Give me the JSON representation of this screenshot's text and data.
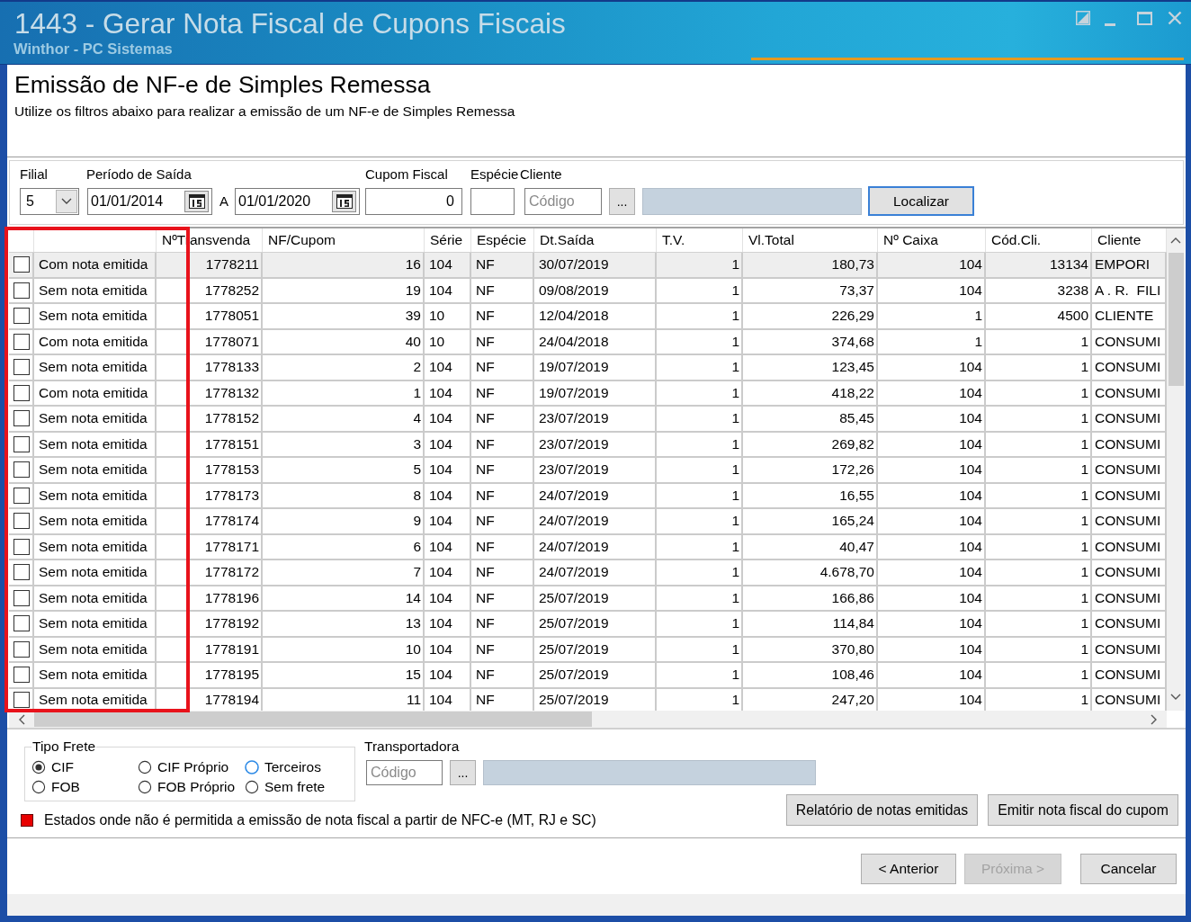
{
  "window": {
    "title": "1443 - Gerar Nota Fiscal de Cupons Fiscais",
    "subtitle": "Winthor - PC Sistemas"
  },
  "intro": {
    "heading": "Emissão de NF-e de Simples Remessa",
    "description": "Utilize os filtros abaixo para realizar a emissão de um NF-e de Simples Remessa"
  },
  "filters": {
    "filial": {
      "label": "Filial",
      "value": "5"
    },
    "periodo": {
      "label": "Período de Saída",
      "from": "01/01/2014",
      "separator": "A",
      "to": "01/01/2020"
    },
    "cupom_fiscal": {
      "label": "Cupom Fiscal",
      "value": "0"
    },
    "especie": {
      "label": "Espécie"
    },
    "cliente": {
      "label": "Cliente",
      "placeholder": "Código",
      "lookup_button": "..."
    },
    "search_button": "Localizar"
  },
  "table": {
    "columns": [
      "NºTransvenda",
      "NF/Cupom",
      "Série",
      "Espécie",
      "Dt.Saída",
      "T.V.",
      "Vl.Total",
      "Nº Caixa",
      "Cód.Cli.",
      "Cliente"
    ],
    "rows": [
      {
        "checked": false,
        "selected": true,
        "status": "Com nota emitida",
        "cells": [
          "1778211",
          "16",
          "104",
          "NF",
          "30/07/2019",
          "1",
          "180,73",
          "104",
          "13134",
          "EMPORI"
        ]
      },
      {
        "checked": false,
        "selected": false,
        "status": "Sem nota emitida",
        "cells": [
          "1778252",
          "19",
          "104",
          "NF",
          "09/08/2019",
          "1",
          "73,37",
          "104",
          "3238",
          "A . R.  FILI"
        ]
      },
      {
        "checked": false,
        "selected": false,
        "status": "Sem nota emitida",
        "cells": [
          "1778051",
          "39",
          "10",
          "NF",
          "12/04/2018",
          "1",
          "226,29",
          "1",
          "4500",
          "CLIENTE"
        ]
      },
      {
        "checked": false,
        "selected": false,
        "status": "Com nota emitida",
        "cells": [
          "1778071",
          "40",
          "10",
          "NF",
          "24/04/2018",
          "1",
          "374,68",
          "1",
          "1",
          "CONSUMI"
        ]
      },
      {
        "checked": false,
        "selected": false,
        "status": "Sem nota emitida",
        "cells": [
          "1778133",
          "2",
          "104",
          "NF",
          "19/07/2019",
          "1",
          "123,45",
          "104",
          "1",
          "CONSUMI"
        ]
      },
      {
        "checked": false,
        "selected": false,
        "status": "Com nota emitida",
        "cells": [
          "1778132",
          "1",
          "104",
          "NF",
          "19/07/2019",
          "1",
          "418,22",
          "104",
          "1",
          "CONSUMI"
        ]
      },
      {
        "checked": false,
        "selected": false,
        "status": "Sem nota emitida",
        "cells": [
          "1778152",
          "4",
          "104",
          "NF",
          "23/07/2019",
          "1",
          "85,45",
          "104",
          "1",
          "CONSUMI"
        ]
      },
      {
        "checked": false,
        "selected": false,
        "status": "Sem nota emitida",
        "cells": [
          "1778151",
          "3",
          "104",
          "NF",
          "23/07/2019",
          "1",
          "269,82",
          "104",
          "1",
          "CONSUMI"
        ]
      },
      {
        "checked": false,
        "selected": false,
        "status": "Sem nota emitida",
        "cells": [
          "1778153",
          "5",
          "104",
          "NF",
          "23/07/2019",
          "1",
          "172,26",
          "104",
          "1",
          "CONSUMI"
        ]
      },
      {
        "checked": false,
        "selected": false,
        "status": "Sem nota emitida",
        "cells": [
          "1778173",
          "8",
          "104",
          "NF",
          "24/07/2019",
          "1",
          "16,55",
          "104",
          "1",
          "CONSUMI"
        ]
      },
      {
        "checked": false,
        "selected": false,
        "status": "Sem nota emitida",
        "cells": [
          "1778174",
          "9",
          "104",
          "NF",
          "24/07/2019",
          "1",
          "165,24",
          "104",
          "1",
          "CONSUMI"
        ]
      },
      {
        "checked": false,
        "selected": false,
        "status": "Sem nota emitida",
        "cells": [
          "1778171",
          "6",
          "104",
          "NF",
          "24/07/2019",
          "1",
          "40,47",
          "104",
          "1",
          "CONSUMI"
        ]
      },
      {
        "checked": false,
        "selected": false,
        "status": "Sem nota emitida",
        "cells": [
          "1778172",
          "7",
          "104",
          "NF",
          "24/07/2019",
          "1",
          "4.678,70",
          "104",
          "1",
          "CONSUMI"
        ]
      },
      {
        "checked": false,
        "selected": false,
        "status": "Sem nota emitida",
        "cells": [
          "1778196",
          "14",
          "104",
          "NF",
          "25/07/2019",
          "1",
          "166,86",
          "104",
          "1",
          "CONSUMI"
        ]
      },
      {
        "checked": false,
        "selected": false,
        "status": "Sem nota emitida",
        "cells": [
          "1778192",
          "13",
          "104",
          "NF",
          "25/07/2019",
          "1",
          "114,84",
          "104",
          "1",
          "CONSUMI"
        ]
      },
      {
        "checked": false,
        "selected": false,
        "status": "Sem nota emitida",
        "cells": [
          "1778191",
          "10",
          "104",
          "NF",
          "25/07/2019",
          "1",
          "370,80",
          "104",
          "1",
          "CONSUMI"
        ]
      },
      {
        "checked": false,
        "selected": false,
        "status": "Sem nota emitida",
        "cells": [
          "1778195",
          "15",
          "104",
          "NF",
          "25/07/2019",
          "1",
          "108,46",
          "104",
          "1",
          "CONSUMI"
        ]
      },
      {
        "checked": false,
        "selected": false,
        "status": "Sem nota emitida",
        "cells": [
          "1778194",
          "11",
          "104",
          "NF",
          "25/07/2019",
          "1",
          "247,20",
          "104",
          "1",
          "CONSUMI"
        ]
      }
    ]
  },
  "freight": {
    "label": "Tipo Frete",
    "options": [
      {
        "label": "CIF",
        "selected": true,
        "highlighted": false
      },
      {
        "label": "CIF Próprio",
        "selected": false,
        "highlighted": false
      },
      {
        "label": "Terceiros",
        "selected": false,
        "highlighted": true
      },
      {
        "label": "FOB",
        "selected": false,
        "highlighted": false
      },
      {
        "label": "FOB Próprio",
        "selected": false,
        "highlighted": false
      },
      {
        "label": "Sem frete",
        "selected": false,
        "highlighted": false
      }
    ]
  },
  "carrier": {
    "label": "Transportadora",
    "placeholder": "Código",
    "lookup_button": "..."
  },
  "note": "Estados onde não é permitida a emissão de nota fiscal a partir de NFC-e (MT, RJ e SC)",
  "actions": [
    "Relatório de notas emitidas",
    "Emitir nota fiscal do cupom"
  ],
  "navigation": [
    {
      "label": "< Anterior",
      "disabled": false
    },
    {
      "label": "Próxima >",
      "disabled": true
    },
    {
      "label": "Cancelar",
      "disabled": false
    }
  ]
}
